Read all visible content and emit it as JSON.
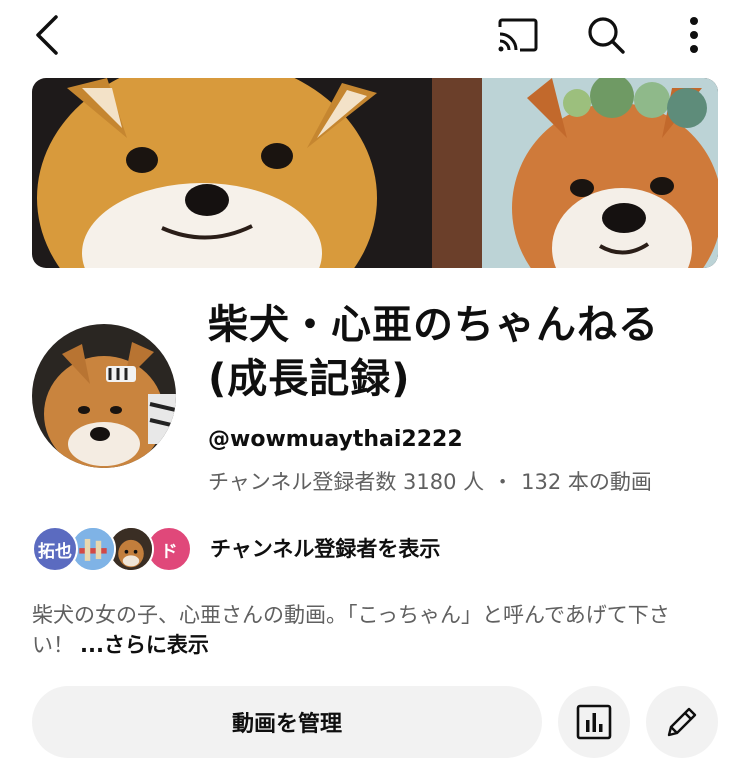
{
  "header": {
    "icons": [
      "back-arrow-icon",
      "cast-icon",
      "search-icon",
      "more-vert-icon"
    ]
  },
  "channel": {
    "title": "柴犬・心亜のちゃんねる(成長記録)",
    "handle": "@wowmuaythai2222",
    "subscribers": "チャンネル登録者数 3180 人",
    "separator": "・",
    "videos": "132 本の動画"
  },
  "subscribers_preview": {
    "avatars": [
      {
        "text": "拓也",
        "color": "#5b6bc0"
      },
      {
        "text": "",
        "color": "#6aa8e0"
      },
      {
        "text": "",
        "color": "#4a3a2a"
      },
      {
        "text": "ド",
        "color": "#e0487a"
      }
    ],
    "label": "チャンネル登録者を表示"
  },
  "description": {
    "text": "柴犬の女の子、心亜さんの動画。「こっちゃん」と呼んであげて下さい！",
    "more_label": "...さらに表示"
  },
  "actions": {
    "manage_label": "動画を管理",
    "analytics_icon": "analytics-icon",
    "edit_icon": "edit-pencil-icon"
  }
}
